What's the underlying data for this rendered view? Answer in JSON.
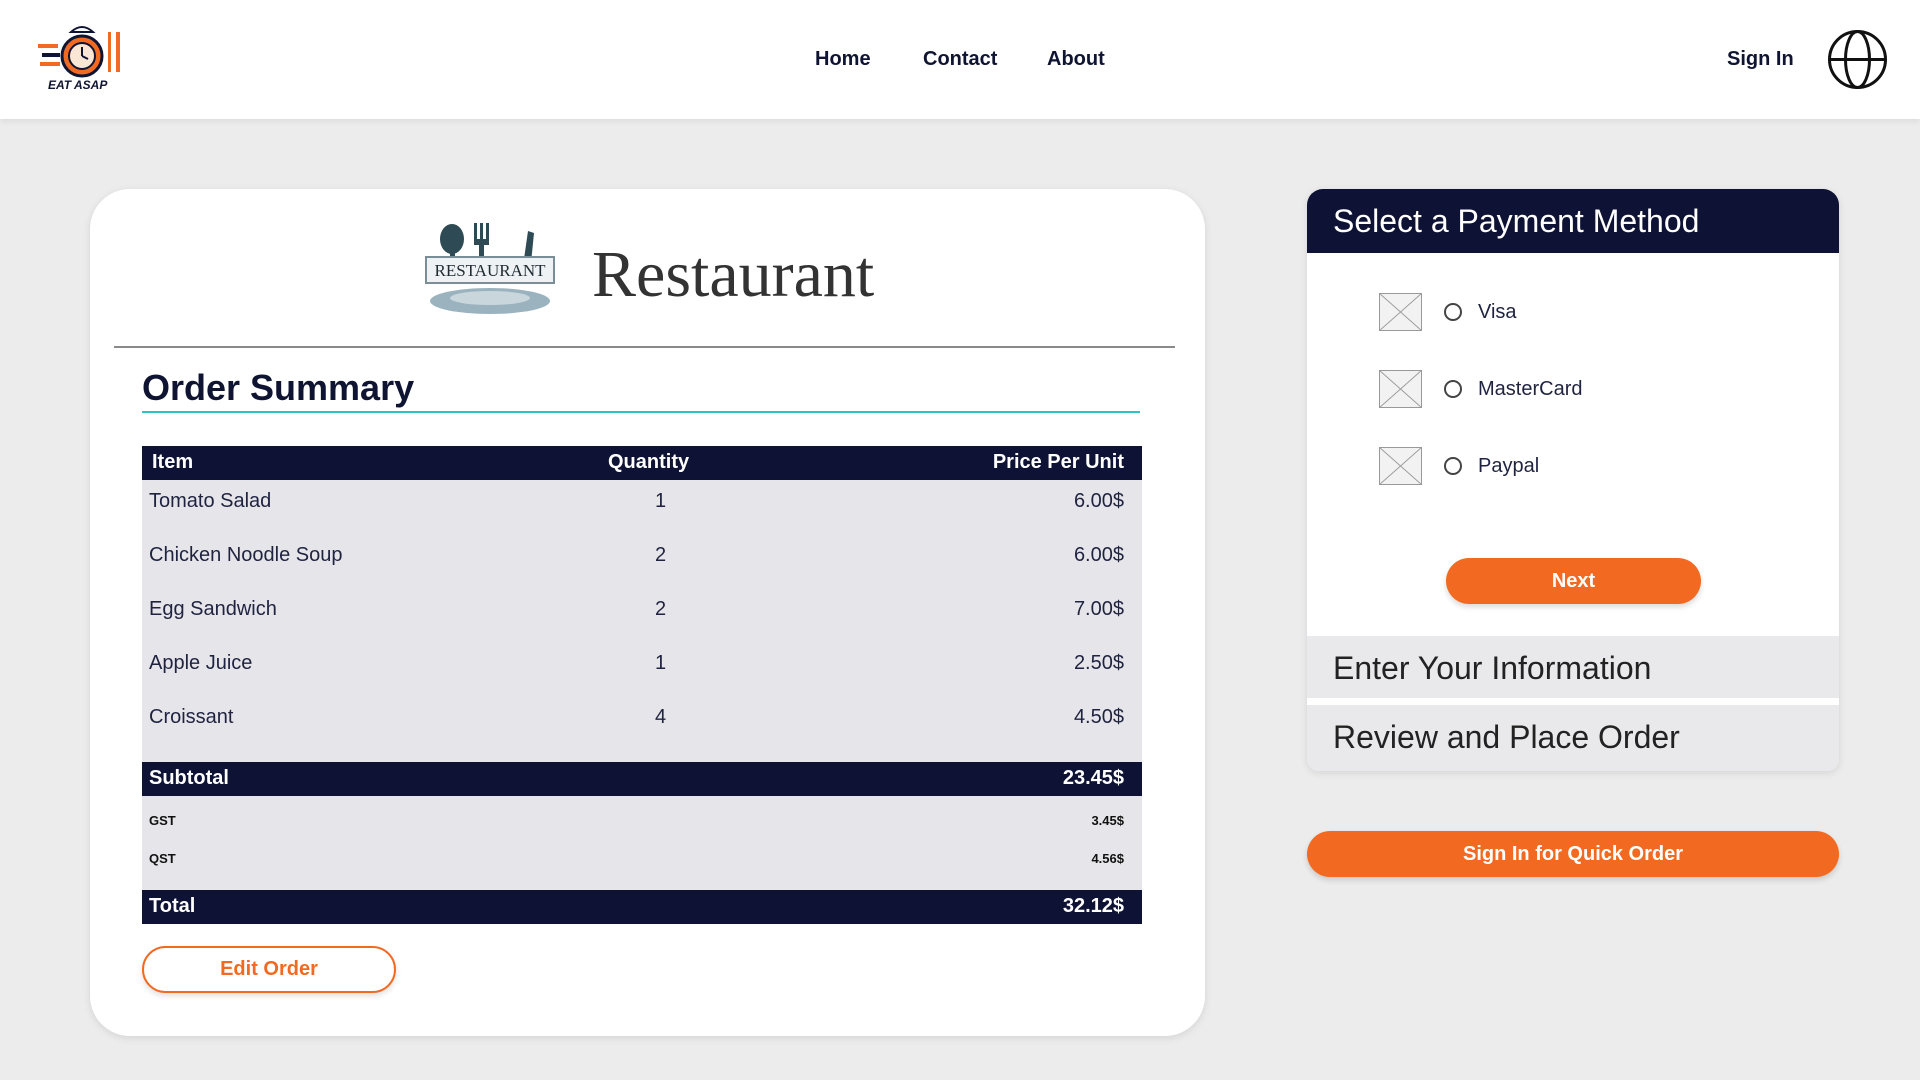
{
  "header": {
    "nav": [
      "Home",
      "Contact",
      "About"
    ],
    "sign_in": "Sign In",
    "logo_text": "EAT ASAP"
  },
  "restaurant": {
    "logo_text": "RESTAURANT",
    "title": "Restaurant"
  },
  "order": {
    "title": "Order Summary",
    "columns": [
      "Item",
      "Quantity",
      "Price Per Unit"
    ],
    "items": [
      {
        "name": "Tomato Salad",
        "qty": "1",
        "price": "6.00$"
      },
      {
        "name": "Chicken Noodle Soup",
        "qty": "2",
        "price": "6.00$"
      },
      {
        "name": "Egg Sandwich",
        "qty": "2",
        "price": "7.00$"
      },
      {
        "name": "Apple Juice",
        "qty": "1",
        "price": "2.50$"
      },
      {
        "name": "Croissant",
        "qty": "4",
        "price": "4.50$"
      }
    ],
    "subtotal_label": "Subtotal",
    "subtotal": "23.45$",
    "gst_label": "GST",
    "gst": "3.45$",
    "qst_label": "QST",
    "qst": "4.56$",
    "total_label": "Total",
    "total": "32.12$",
    "edit_button": "Edit Order"
  },
  "payment": {
    "title": "Select a Payment Method",
    "options": [
      "Visa",
      "MasterCard",
      "Paypal"
    ],
    "next_button": "Next",
    "step_info": "Enter Your Information",
    "step_review": "Review and Place Order",
    "quick_button": "Sign In for Quick Order"
  },
  "colors": {
    "navy": "#0e1234",
    "accent_orange": "#f26a21",
    "teal_underline": "#2fc4c4",
    "page_bg": "#ececec"
  }
}
